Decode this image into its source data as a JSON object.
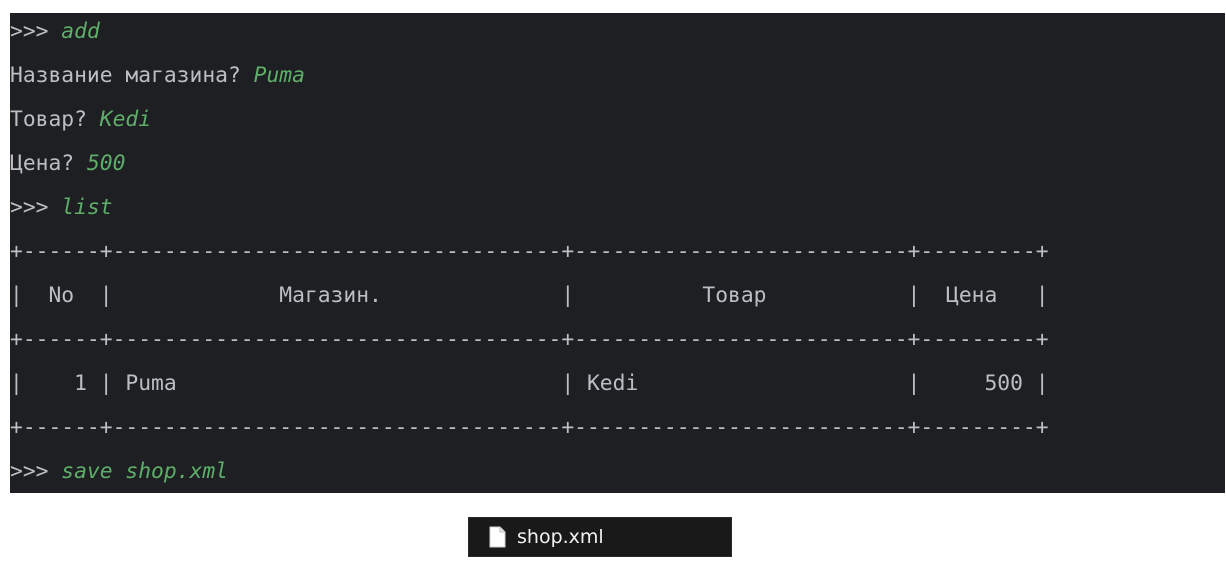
{
  "terminal": {
    "prompt": ">>>",
    "commands": {
      "add": "add",
      "list": "list",
      "save": "save shop.xml"
    },
    "questions": [
      {
        "label": "Название магазина?",
        "answer": "Puma"
      },
      {
        "label": "Товар?",
        "answer": "Kedi"
      },
      {
        "label": "Цена?",
        "answer": "500"
      }
    ],
    "table": {
      "separator": "+------+-----------------------------------+--------------------------+---------+",
      "header_row": "|  No  |             Магазин.              |          Товар           |  Цена   |",
      "rows": [
        "|    1 | Puma                              | Kedi                     |     500 |"
      ],
      "columns": [
        "No",
        "Магазин.",
        "Товар",
        "Цена"
      ],
      "data": [
        {
          "no": "1",
          "shop": "Puma",
          "product": "Kedi",
          "price": "500"
        }
      ]
    },
    "colors": {
      "background": "#1e1f22",
      "text": "#bcbec4",
      "input": "#5fae6a"
    }
  },
  "file_chip": {
    "name": "shop.xml",
    "icon": "file-icon"
  }
}
